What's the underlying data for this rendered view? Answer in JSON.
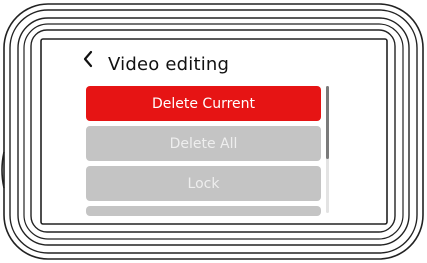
{
  "header": {
    "title": "Video editing"
  },
  "menu": {
    "items": [
      {
        "label": "Delete Current",
        "selected": true
      },
      {
        "label": "Delete All",
        "selected": false
      },
      {
        "label": "Lock",
        "selected": false
      }
    ],
    "partially_visible_next": ""
  },
  "colors": {
    "selected": "#e61414",
    "unselected": "#c4c4c4",
    "frame": "#222222"
  },
  "icons": {
    "back": "chevron-left-icon"
  }
}
